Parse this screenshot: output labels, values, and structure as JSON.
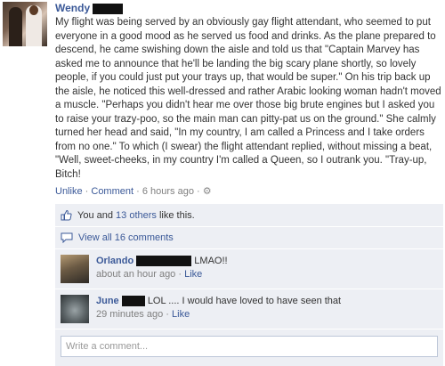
{
  "post": {
    "author": "Wendy",
    "text": "My flight was being served by an obviously gay flight attendant, who seemed to put everyone in a good mood as he served us food and drinks. As the plane prepared to descend, he came swishing down the aisle and told us that \"Captain Marvey has asked me to announce that he'll be landing the big scary plane shortly, so lovely people, if you could just put your trays up, that would be super.\" On his trip back up the aisle, he noticed this well-dressed and rather Arabic looking woman hadn't moved a muscle. \"Perhaps you didn't hear me over those big brute engines but I asked you to raise your trazy-poo, so the main man can pitty-pat us on the ground.\" She calmly turned her head and said, \"In my country, I am called a Princess and I take orders from no one.\" To which (I swear) the flight attendant replied, without missing a beat, \"Well, sweet-cheeks, in my country I'm called a Queen, so I outrank you. \"Tray-up, Bitch!",
    "unlike": "Unlike",
    "comment": "Comment",
    "time": "6 hours ago",
    "sep": "·",
    "likes_prefix": "You and",
    "likes_link": "13 others",
    "likes_suffix": "like this.",
    "view_all": "View all 16 comments"
  },
  "comments": [
    {
      "name": "Orlando",
      "text": "LMAO!!",
      "time": "about an hour ago",
      "like": "Like"
    },
    {
      "name": "June",
      "text": "LOL .... I would have loved to have seen that",
      "time": "29 minutes ago",
      "like": "Like"
    }
  ],
  "composer": {
    "placeholder": "Write a comment..."
  },
  "colors": {
    "link": "#3b5998",
    "box": "#edeff4"
  }
}
